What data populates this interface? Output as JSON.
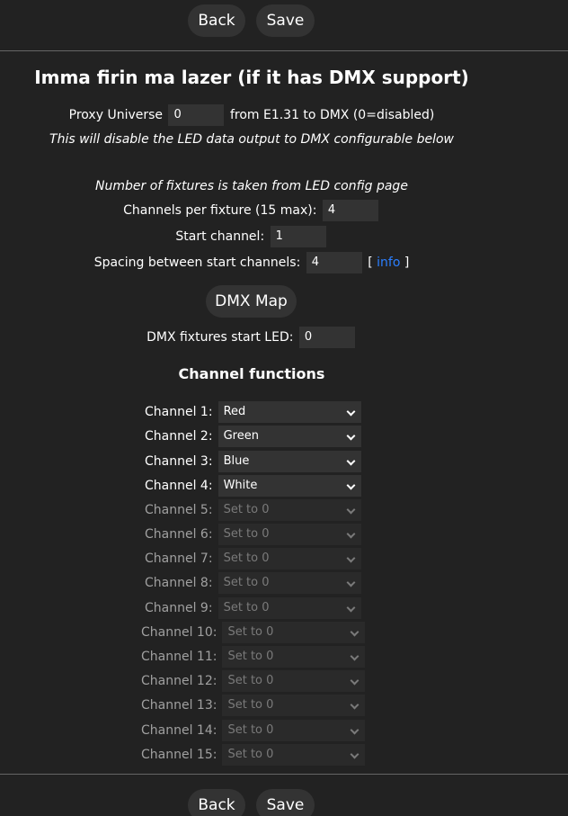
{
  "nav": {
    "back_label": "Back",
    "save_label": "Save"
  },
  "title": "Imma firin ma lazer (if it has DMX support)",
  "proxy": {
    "label": "Proxy Universe",
    "value": "0",
    "suffix": "from E1.31 to DMX (0=disabled)",
    "note": "This will disable the LED data output to DMX configurable below"
  },
  "fixtures": {
    "note": "Number of fixtures is taken from LED config page",
    "channels_per_fixture_label": "Channels per fixture (15 max):",
    "channels_per_fixture_value": "4",
    "start_channel_label": "Start channel:",
    "start_channel_value": "1",
    "spacing_label": "Spacing between start channels:",
    "spacing_value": "4",
    "info_open": "[",
    "info_link": "info",
    "info_close": "]"
  },
  "dmx_map_label": "DMX Map",
  "start_led": {
    "label": "DMX fixtures start LED:",
    "value": "0"
  },
  "channel_functions_title": "Channel functions",
  "channels": [
    {
      "label": "Channel 1:",
      "value": "Red"
    },
    {
      "label": "Channel 2:",
      "value": "Green"
    },
    {
      "label": "Channel 3:",
      "value": "Blue"
    },
    {
      "label": "Channel 4:",
      "value": "White"
    },
    {
      "label": "Channel 5:",
      "value": "Set to 0"
    },
    {
      "label": "Channel 6:",
      "value": "Set to 0"
    },
    {
      "label": "Channel 7:",
      "value": "Set to 0"
    },
    {
      "label": "Channel 8:",
      "value": "Set to 0"
    },
    {
      "label": "Channel 9:",
      "value": "Set to 0"
    },
    {
      "label": "Channel 10:",
      "value": "Set to 0"
    },
    {
      "label": "Channel 11:",
      "value": "Set to 0"
    },
    {
      "label": "Channel 12:",
      "value": "Set to 0"
    },
    {
      "label": "Channel 13:",
      "value": "Set to 0"
    },
    {
      "label": "Channel 14:",
      "value": "Set to 0"
    },
    {
      "label": "Channel 15:",
      "value": "Set to 0"
    }
  ]
}
